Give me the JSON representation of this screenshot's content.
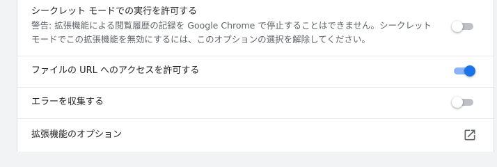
{
  "settings": {
    "incognito": {
      "label": "シークレット モードでの実行を許可する",
      "warning_line1": "警告: 拡張機能による閲覧履歴の記録を Google Chrome で停止することはできません。シークレット",
      "warning_line2": "モードでこの拡張機能を無効にするには、このオプションの選択を解除してください。",
      "enabled": false
    },
    "file_urls": {
      "label": "ファイルの URL へのアクセスを許可する",
      "enabled": true
    },
    "collect_errors": {
      "label": "エラーを収集する",
      "enabled": false
    },
    "extension_options": {
      "label": "拡張機能のオプション",
      "icon": "open-in-new-icon"
    }
  },
  "colors": {
    "toggle_on_knob": "#1a73e8",
    "toggle_on_track": "#8ab4f8",
    "toggle_off_track": "#bdc1c6",
    "text_primary": "#202124",
    "text_secondary": "#5f6368"
  }
}
